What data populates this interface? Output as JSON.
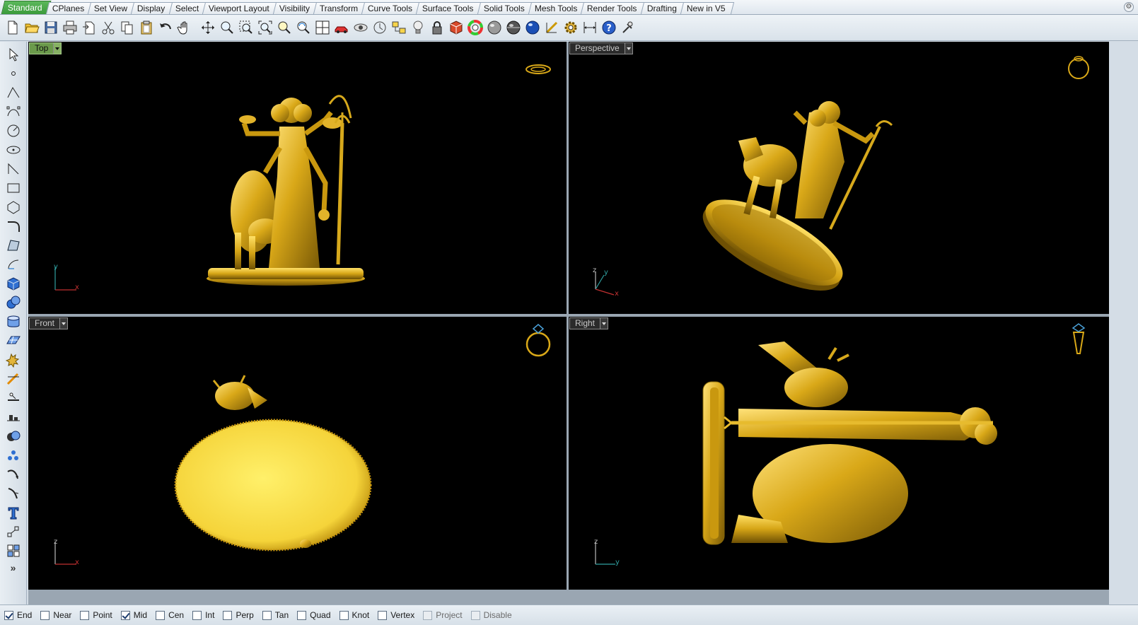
{
  "tabs": [
    {
      "label": "Standard",
      "active": true
    },
    {
      "label": "CPlanes"
    },
    {
      "label": "Set View"
    },
    {
      "label": "Display"
    },
    {
      "label": "Select"
    },
    {
      "label": "Viewport Layout"
    },
    {
      "label": "Visibility"
    },
    {
      "label": "Transform"
    },
    {
      "label": "Curve Tools"
    },
    {
      "label": "Surface Tools"
    },
    {
      "label": "Solid Tools"
    },
    {
      "label": "Mesh Tools"
    },
    {
      "label": "Render Tools"
    },
    {
      "label": "Drafting"
    },
    {
      "label": "New in V5"
    }
  ],
  "toolbar_icons": [
    "new-document-icon",
    "open-folder-icon",
    "save-icon",
    "print-icon",
    "import-icon",
    "cut-icon",
    "copy-icon",
    "paste-icon",
    "undo-icon",
    "pan-hand-icon",
    "move-icon",
    "zoom-icon",
    "zoom-window-icon",
    "zoom-extents-icon",
    "zoom-selected-icon",
    "rotate-view-icon",
    "four-viewports-icon",
    "car-model-icon",
    "named-view-icon",
    "camera-icon",
    "layers-icon",
    "light-bulb-icon",
    "lock-icon",
    "material-icon",
    "color-wheel-icon",
    "shaded-sphere-icon",
    "rendered-sphere-icon",
    "render-icon",
    "render-blue-sphere-icon",
    "measure-icon",
    "options-gear-icon",
    "dimension-icon",
    "help-icon",
    "tools-icon"
  ],
  "left_tools": [
    "select-arrow-icon",
    "point-icon",
    "polyline-icon",
    "curve-control-points-icon",
    "circle-icon",
    "ellipse-icon",
    "arc-icon",
    "rectangle-icon",
    "polygon-icon",
    "fillet-curve-icon",
    "surface-corner-icon",
    "extrude-surface-icon",
    "box-solid-icon",
    "sphere-solid-icon",
    "cylinder-solid-icon",
    "mesh-plane-icon",
    "explode-icon",
    "trim-icon",
    "split-icon",
    "align-icon",
    "boolean-icon",
    "array-icon",
    "bend-icon",
    "twist-icon",
    "text-icon",
    "dimension-linear-icon",
    "group-icon"
  ],
  "left_more": "»",
  "viewports": {
    "top": {
      "label": "Top",
      "active": true,
      "axes": [
        "y",
        "x"
      ]
    },
    "perspective": {
      "label": "Perspective",
      "axes": [
        "z",
        "y",
        "x"
      ]
    },
    "front": {
      "label": "Front",
      "axes": [
        "z",
        "x"
      ]
    },
    "right": {
      "label": "Right",
      "axes": [
        "z",
        "y"
      ]
    }
  },
  "colors": {
    "model_gold": "#d9a818",
    "model_highlight": "#ffe066",
    "model_shadow": "#7a5a06",
    "active_label": "#6b9a4b",
    "axis_x": "#c03030",
    "axis_y": "#30a0a0",
    "axis_z": "#bbbbbb"
  },
  "osnaps": [
    {
      "label": "End",
      "checked": true
    },
    {
      "label": "Near",
      "checked": false
    },
    {
      "label": "Point",
      "checked": false
    },
    {
      "label": "Mid",
      "checked": true
    },
    {
      "label": "Cen",
      "checked": false
    },
    {
      "label": "Int",
      "checked": false
    },
    {
      "label": "Perp",
      "checked": false
    },
    {
      "label": "Tan",
      "checked": false
    },
    {
      "label": "Quad",
      "checked": false
    },
    {
      "label": "Knot",
      "checked": false
    },
    {
      "label": "Vertex",
      "checked": false
    },
    {
      "label": "Project",
      "checked": false,
      "disabled": true
    },
    {
      "label": "Disable",
      "checked": false,
      "disabled": true
    }
  ]
}
